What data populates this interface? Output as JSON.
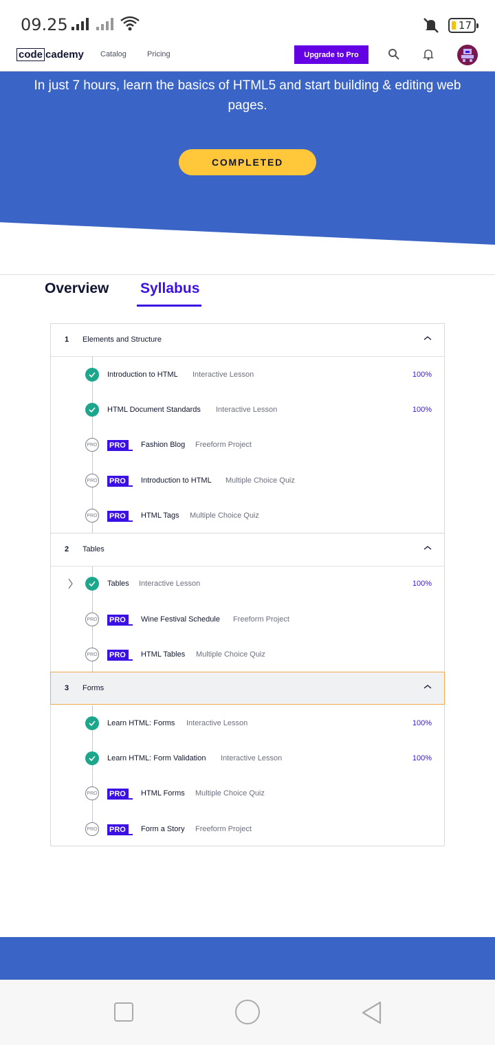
{
  "status_bar": {
    "time": "09.25",
    "battery": "17"
  },
  "nav": {
    "logo_box": "code",
    "logo_rest": "cademy",
    "links": [
      "Catalog",
      "Pricing"
    ],
    "upgrade_label": "Upgrade to Pro"
  },
  "hero": {
    "description": "In just 7 hours, learn the basics of HTML5 and start building & editing web pages.",
    "status_button": "COMPLETED"
  },
  "tabs": {
    "overview": "Overview",
    "syllabus": "Syllabus",
    "active": "syllabus"
  },
  "modules": [
    {
      "number": "1",
      "title": "Elements and Structure",
      "items": [
        {
          "title": "Introduction to HTML",
          "type": "Interactive Lesson",
          "progress": "100%",
          "pro": false,
          "done": true
        },
        {
          "title": "HTML Document Standards",
          "type": "Interactive Lesson",
          "progress": "100%",
          "pro": false,
          "done": true
        },
        {
          "title": "Fashion Blog",
          "type": "Freeform Project",
          "pro": true,
          "done": false
        },
        {
          "title": "Introduction to HTML",
          "type": "Multiple Choice Quiz",
          "pro": true,
          "done": false
        },
        {
          "title": "HTML Tags",
          "type": "Multiple Choice Quiz",
          "pro": true,
          "done": false
        }
      ]
    },
    {
      "number": "2",
      "title": "Tables",
      "items": [
        {
          "title": "Tables",
          "type": "Interactive Lesson",
          "progress": "100%",
          "pro": false,
          "done": true
        },
        {
          "title": "Wine Festival Schedule",
          "type": "Freeform Project",
          "pro": true,
          "done": false
        },
        {
          "title": "HTML Tables",
          "type": "Multiple Choice Quiz",
          "pro": true,
          "done": false
        }
      ]
    },
    {
      "number": "3",
      "title": "Forms",
      "items": [
        {
          "title": "Learn HTML: Forms",
          "type": "Interactive Lesson",
          "progress": "100%",
          "pro": false,
          "done": true
        },
        {
          "title": "Learn HTML: Form Validation",
          "type": "Interactive Lesson",
          "progress": "100%",
          "pro": false,
          "done": true
        },
        {
          "title": "HTML Forms",
          "type": "Multiple Choice Quiz",
          "pro": true,
          "done": false
        },
        {
          "title": "Form a Story",
          "type": "Freeform Project",
          "pro": true,
          "done": false
        }
      ]
    }
  ],
  "labels": {
    "pro_badge": "PRO",
    "pro_circle": "PRO"
  },
  "colors": {
    "hero_blue": "#3a64c6",
    "accent_purple": "#3a10e5",
    "button_yellow": "#ffc739",
    "check_green": "#1ca68b"
  },
  "icons": [
    "signal-icon",
    "wifi-icon",
    "mute-icon",
    "battery-icon",
    "search-icon",
    "bell-icon",
    "avatar",
    "check-icon",
    "chevron-up-icon",
    "chevron-right-icon"
  ]
}
